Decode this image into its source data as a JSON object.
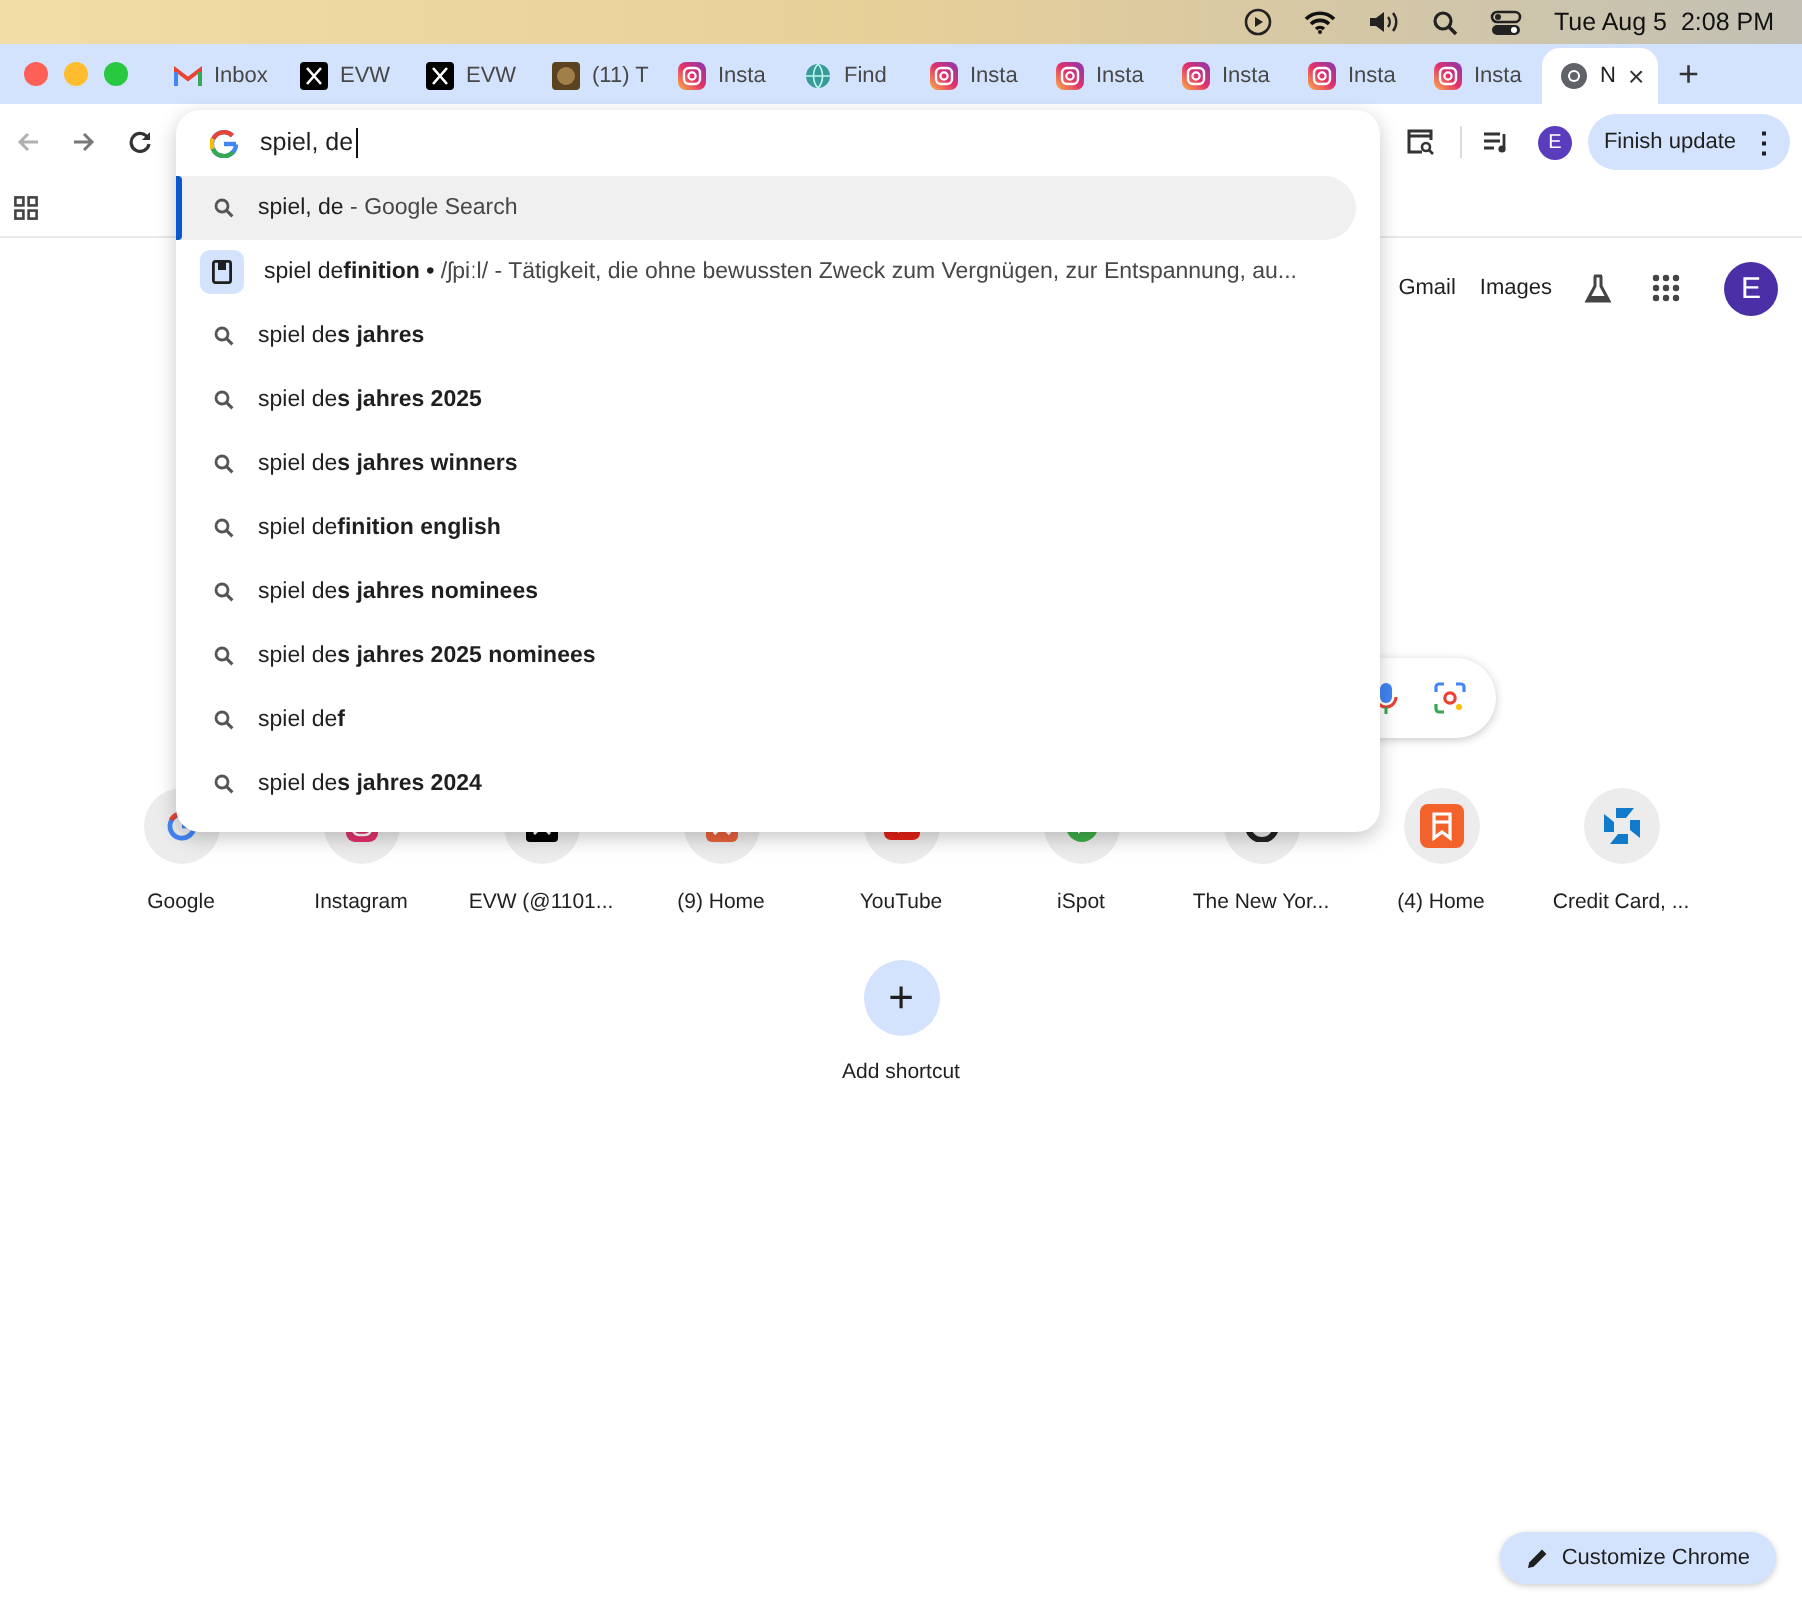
{
  "menu_bar": {
    "clock": "Tue Aug 5  2:08 PM"
  },
  "tabs": [
    {
      "kind": "gmail",
      "title": "Inbox",
      "selected": false
    },
    {
      "kind": "x",
      "title": "EVW",
      "selected": false
    },
    {
      "kind": "x",
      "title": "EVW",
      "selected": false
    },
    {
      "kind": "photo",
      "title": "(11) T",
      "selected": false
    },
    {
      "kind": "instagram",
      "title": "Insta",
      "selected": false
    },
    {
      "kind": "globe",
      "title": "Find",
      "selected": false
    },
    {
      "kind": "instagram",
      "title": "Insta",
      "selected": false
    },
    {
      "kind": "instagram",
      "title": "Insta",
      "selected": false
    },
    {
      "kind": "instagram",
      "title": "Insta",
      "selected": false
    },
    {
      "kind": "instagram",
      "title": "Insta",
      "selected": false
    },
    {
      "kind": "instagram",
      "title": "Insta",
      "selected": false
    },
    {
      "kind": "chrome",
      "title": "N",
      "selected": true,
      "close": "×"
    }
  ],
  "new_tab_button": "+",
  "toolbar": {
    "avatar": "E",
    "update_button": "Finish update",
    "update_menu": "⋮"
  },
  "omnibox": {
    "value": "spiel, de",
    "suggestions": [
      {
        "kind": "search",
        "text": "spiel, de",
        "detail": "- Google Search",
        "selected": true
      },
      {
        "kind": "answer",
        "text": "spiel de**finition** **•**",
        "detail": "/ʃpiːl/ - Tätigkeit, die ohne bewussten Zweck zum Vergnügen, zur Entspannung, au...",
        "selected": false
      },
      {
        "kind": "search",
        "text": "spiel de**s jahres**",
        "selected": false
      },
      {
        "kind": "search",
        "text": "spiel de**s jahres 2025**",
        "selected": false
      },
      {
        "kind": "search",
        "text": "spiel de**s jahres winners**",
        "selected": false
      },
      {
        "kind": "search",
        "text": "spiel de**finition english**",
        "selected": false
      },
      {
        "kind": "search",
        "text": "spiel de**s jahres nominees**",
        "selected": false
      },
      {
        "kind": "search",
        "text": "spiel de**s jahres 2025 nominees**",
        "selected": false
      },
      {
        "kind": "search",
        "text": "spiel de**f**",
        "selected": false
      },
      {
        "kind": "search",
        "text": "spiel de**s jahres 2024**",
        "selected": false
      }
    ]
  },
  "ntp": {
    "links": [
      "Gmail",
      "Images"
    ],
    "avatar": "E",
    "shortcuts": [
      {
        "kind": "google",
        "label": "Google"
      },
      {
        "kind": "instagram",
        "label": "Instagram"
      },
      {
        "kind": "x",
        "label": "EVW (@1101..."
      },
      {
        "kind": "orange",
        "label": "(9) Home"
      },
      {
        "kind": "youtube",
        "label": "YouTube"
      },
      {
        "kind": "ispot",
        "label": "iSpot"
      },
      {
        "kind": "nyt",
        "label": "The New Yor..."
      },
      {
        "kind": "bookmark",
        "label": "(4) Home"
      },
      {
        "kind": "bank",
        "label": "Credit Card, ..."
      }
    ],
    "add_shortcut": {
      "icon": "+",
      "label": "Add shortcut"
    },
    "customize_button": "Customize Chrome"
  }
}
